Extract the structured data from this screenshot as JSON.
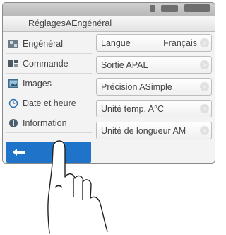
{
  "title": "RéglagesAEngénéral",
  "sidebar": {
    "items": [
      {
        "label": "Engénéral",
        "icon": "general-settings-icon"
      },
      {
        "label": "Commande",
        "icon": "command-icon"
      },
      {
        "label": "Images",
        "icon": "images-icon"
      },
      {
        "label": "Date et heure",
        "icon": "clock-icon"
      },
      {
        "label": "Information",
        "icon": "info-icon"
      }
    ],
    "back_icon": "back-arrow-icon"
  },
  "settings": [
    {
      "label": "Langue",
      "value": "Français"
    },
    {
      "label": "Sortie APAL",
      "value": ""
    },
    {
      "label": "Précision ASimple",
      "value": ""
    },
    {
      "label": "Unité temp. A°C",
      "value": ""
    },
    {
      "label": "Unité de longueur AM",
      "value": ""
    }
  ],
  "colors": {
    "accent": "#1f73c9"
  }
}
